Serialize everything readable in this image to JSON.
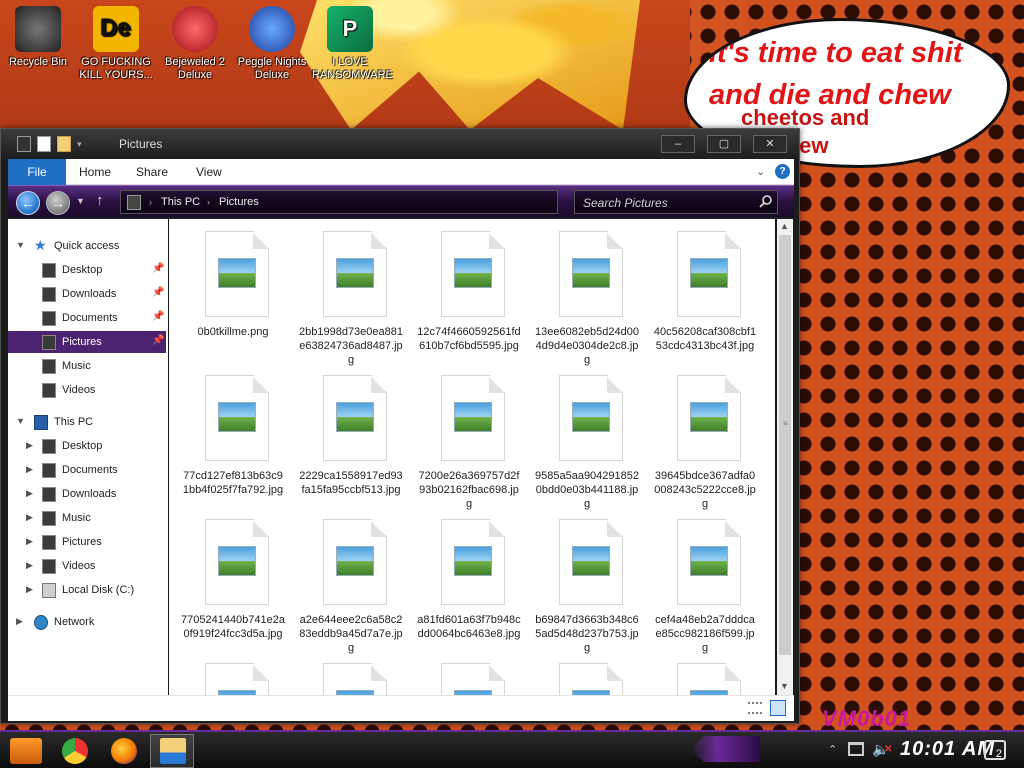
{
  "desktop": {
    "speech_bubble": {
      "line1": "it's time to eat shit",
      "line2": "and die and chew",
      "line3": "cheetos and",
      "line4": "ntain dew"
    },
    "watermark": "VM0b01",
    "icons": [
      {
        "label": "Recycle Bin",
        "icon": "recycle-bin-icon",
        "color": "#3a3a3a"
      },
      {
        "label": "GO FUCKING KILL YOURS...",
        "icon": "de-app-icon",
        "color": "#f2b600"
      },
      {
        "label": "Bejeweled 2 Deluxe",
        "icon": "bejeweled-icon",
        "color": "#d8232a"
      },
      {
        "label": "Peggle Nights Deluxe",
        "icon": "peggle-icon",
        "color": "#2d6ad6"
      },
      {
        "label": "I LOVE RANSOMWARE",
        "icon": "publisher-icon",
        "color": "#0d8a4f"
      }
    ]
  },
  "window": {
    "title": "Pictures",
    "buttons": {
      "minimize": "–",
      "maximize": "▢",
      "close": "✕"
    },
    "ribbon": {
      "file": "File",
      "home": "Home",
      "share": "Share",
      "view": "View",
      "help": "?"
    },
    "address": {
      "crumb_pc": "This PC",
      "crumb_pictures": "Pictures",
      "separator": "›"
    },
    "search": {
      "placeholder": "Search Pictures"
    },
    "nav": {
      "quick_access": "Quick access",
      "qa_items": [
        "Desktop",
        "Downloads",
        "Documents",
        "Pictures",
        "Music",
        "Videos"
      ],
      "this_pc": "This PC",
      "pc_items": [
        "Desktop",
        "Documents",
        "Downloads",
        "Music",
        "Pictures",
        "Videos"
      ],
      "local_disk": "Local Disk (C:)",
      "network": "Network"
    },
    "files": [
      "0b0tkillme.png",
      "2bb1998d73e0ea881e63824736ad8487.jpg",
      "12c74f4660592561fd610b7cf6bd5595.jpg",
      "13ee6082eb5d24d004d9d4e0304de2c8.jpg",
      "40c56208caf308cbf153cdc4313bc43f.jpg",
      "77cd127ef813b63c91bb4f025f7fa792.jpg",
      "2229ca1558917ed93fa15fa95ccbf513.jpg",
      "7200e26a369757d2f93b02162fbac698.jpg",
      "9585a5aa9042918520bdd0e03b441188.jpg",
      "39645bdce367adfa0008243c5222cce8.jpg",
      "7705241440b741e2a0f919f24fcc3d5a.jpg",
      "a2e644eee2c6a58c283eddb9a45d7a7e.jpg",
      "a81fd601a63f7b948cdd0064bc6463e8.jpg",
      "b69847d3663b348c65ad5d48d237b753.jpg",
      "cef4a48eb2a7dddcae85cc982186f599.jpg",
      "",
      "",
      "",
      "",
      ""
    ]
  },
  "taskbar": {
    "clock": "10:01 AM",
    "notifications": "2"
  }
}
